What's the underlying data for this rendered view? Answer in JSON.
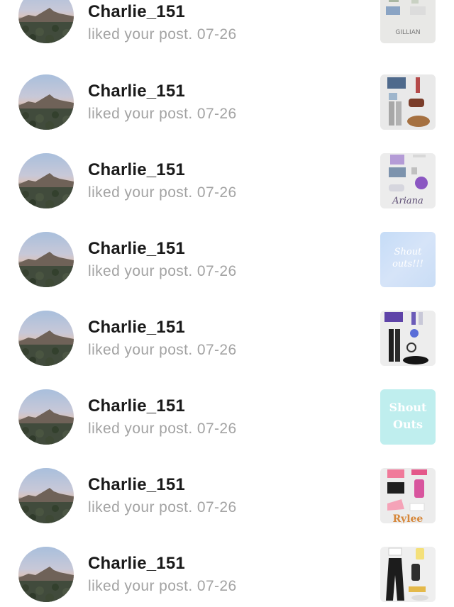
{
  "notifications": [
    {
      "username": "Charlie_151",
      "message": "liked your post. 07-26",
      "thumb_style": "outfit-gillian",
      "thumb_caption": "GILLIAN"
    },
    {
      "username": "Charlie_151",
      "message": "liked your post. 07-26",
      "thumb_style": "outfit-blue-grey",
      "thumb_caption": ""
    },
    {
      "username": "Charlie_151",
      "message": "liked your post. 07-26",
      "thumb_style": "outfit-ariana",
      "thumb_caption": "Ariana"
    },
    {
      "username": "Charlie_151",
      "message": "liked your post. 07-26",
      "thumb_style": "shout-outs-blue",
      "thumb_caption": "Shout outs!!!"
    },
    {
      "username": "Charlie_151",
      "message": "liked your post. 07-26",
      "thumb_style": "outfit-purple-black",
      "thumb_caption": ""
    },
    {
      "username": "Charlie_151",
      "message": "liked your post. 07-26",
      "thumb_style": "shout-outs-teal",
      "thumb_caption": "Shout Outs"
    },
    {
      "username": "Charlie_151",
      "message": "liked your post. 07-26",
      "thumb_style": "outfit-pink",
      "thumb_caption": "Rylee"
    },
    {
      "username": "Charlie_151",
      "message": "liked your post. 07-26",
      "thumb_style": "outfit-flare",
      "thumb_caption": ""
    }
  ],
  "colors": {
    "username": "#1a1a1a",
    "message": "#a3a3a3",
    "background": "#ffffff"
  }
}
